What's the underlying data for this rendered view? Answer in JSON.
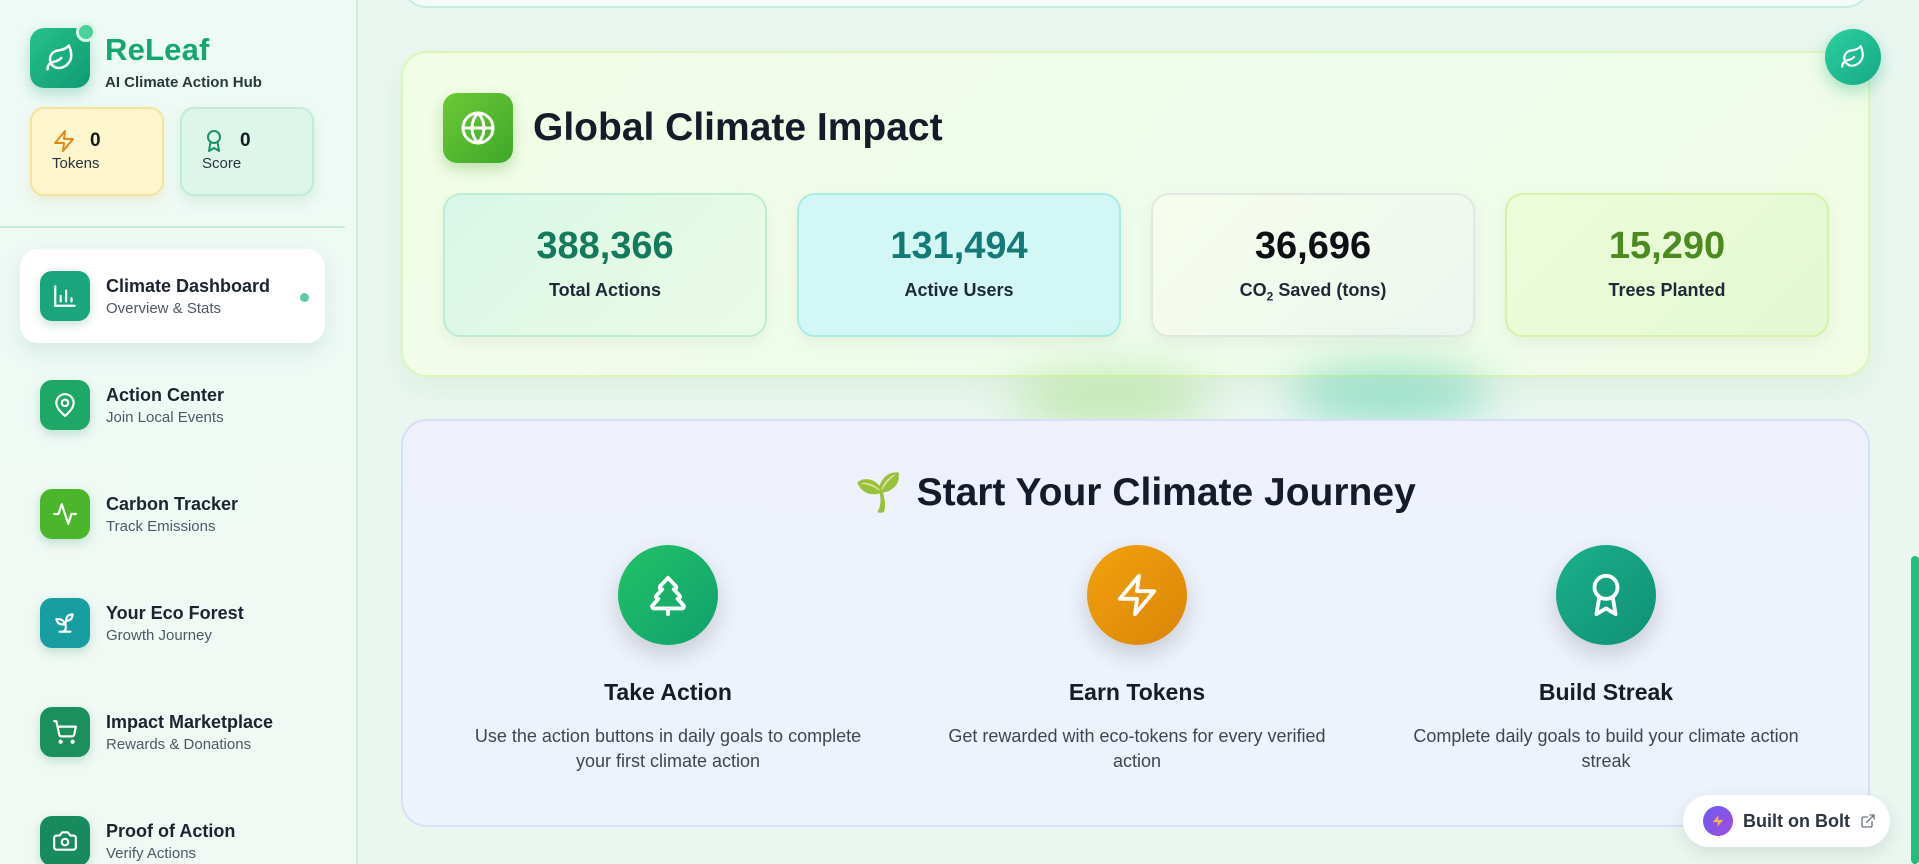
{
  "brand": {
    "title": "ReLeaf",
    "subtitle": "AI Climate Action Hub"
  },
  "stats": {
    "tokens": {
      "value": "0",
      "label": "Tokens"
    },
    "score": {
      "value": "0",
      "label": "Score"
    }
  },
  "nav": [
    {
      "title": "Climate Dashboard",
      "subtitle": "Overview & Stats",
      "icon": "bar-chart-icon",
      "color": "#1aa57d",
      "active": true
    },
    {
      "title": "Action Center",
      "subtitle": "Join Local Events",
      "icon": "map-pin-icon",
      "color": "#1ea766"
    },
    {
      "title": "Carbon Tracker",
      "subtitle": "Track Emissions",
      "icon": "activity-icon",
      "color": "#4bb52c"
    },
    {
      "title": "Your Eco Forest",
      "subtitle": "Growth Journey",
      "icon": "sprout-icon",
      "color": "#189ea0"
    },
    {
      "title": "Impact Marketplace",
      "subtitle": "Rewards & Donations",
      "icon": "cart-icon",
      "color": "#1b8f5c"
    },
    {
      "title": "Proof of Action",
      "subtitle": "Verify Actions",
      "icon": "camera-icon",
      "color": "#178a5e"
    }
  ],
  "impact": {
    "title": "Global Climate Impact",
    "metrics": [
      {
        "value": "388,366",
        "label": "Total Actions"
      },
      {
        "value": "131,494",
        "label": "Active Users"
      },
      {
        "value": "36,696",
        "label_main": "CO",
        "label_sub": "2",
        "label_rest": " Saved (tons)"
      },
      {
        "value": "15,290",
        "label": "Trees Planted"
      }
    ]
  },
  "journey": {
    "emoji": "🌱",
    "title": "Start Your Climate Journey",
    "steps": [
      {
        "title": "Take Action",
        "desc": "Use the action buttons in daily goals to complete your first climate action",
        "icon": "tree-icon"
      },
      {
        "title": "Earn Tokens",
        "desc": "Get rewarded with eco-tokens for every verified action",
        "icon": "lightning-icon"
      },
      {
        "title": "Build Streak",
        "desc": "Complete daily goals to build your climate action streak",
        "icon": "award-icon"
      }
    ]
  },
  "badge": {
    "label": "Built on Bolt"
  },
  "colors": {
    "brand": "#12a86f",
    "accent": "#20c07c"
  }
}
